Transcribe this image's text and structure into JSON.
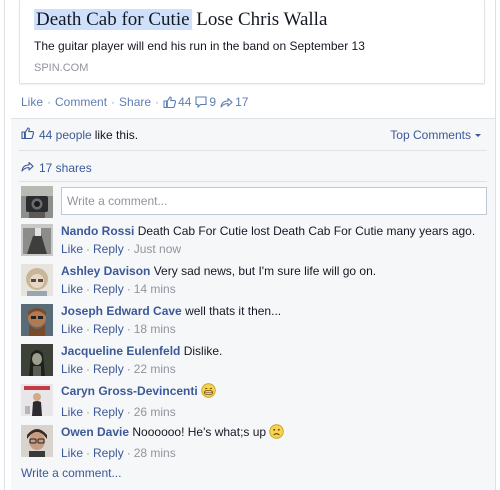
{
  "card": {
    "title_highlight": "Death Cab for Cutie",
    "title_rest": " Lose Chris Walla",
    "description": "The guitar player will end his run in the band on September 13",
    "domain": "SPIN.COM"
  },
  "actions": {
    "like": "Like",
    "comment": "Comment",
    "share": "Share",
    "like_count": "44",
    "comment_count": "9",
    "share_count": "17"
  },
  "feedback": {
    "likes_link": "44 people",
    "likes_suffix": "like this.",
    "top_comments": "Top Comments",
    "shares": "17 shares",
    "composer_placeholder": "Write a comment...",
    "write_comment_bottom": "Write a comment..."
  },
  "comments": [
    {
      "name": "Nando Rossi",
      "text": "Death Cab For Cutie lost Death Cab For Cutie many years ago.",
      "like": "Like",
      "reply": "Reply",
      "time": "Just now",
      "emoji": ""
    },
    {
      "name": "Ashley Davison",
      "text": "Very sad news, but I'm sure life will go on.",
      "like": "Like",
      "reply": "Reply",
      "time": "14 mins",
      "emoji": ""
    },
    {
      "name": "Joseph Edward Cave",
      "text": "well thats it then...",
      "like": "Like",
      "reply": "Reply",
      "time": "18 mins",
      "emoji": ""
    },
    {
      "name": "Jacqueline Eulenfeld",
      "text": "Dislike.",
      "like": "Like",
      "reply": "Reply",
      "time": "22 mins",
      "emoji": ""
    },
    {
      "name": "Caryn Gross-Devincenti",
      "text": "",
      "like": "Like",
      "reply": "Reply",
      "time": "26 mins",
      "emoji": "grin-emoji"
    },
    {
      "name": "Owen Davie",
      "text": "Noooooo! He's what;s up",
      "like": "Like",
      "reply": "Reply",
      "time": "28 mins",
      "emoji": "frown-emoji"
    }
  ],
  "colors": {
    "link": "#3b5998",
    "action_link": "#5f7db4",
    "muted": "#90949c",
    "highlight": "#cfe1fa",
    "feedback_bg": "#f6f7f9"
  }
}
